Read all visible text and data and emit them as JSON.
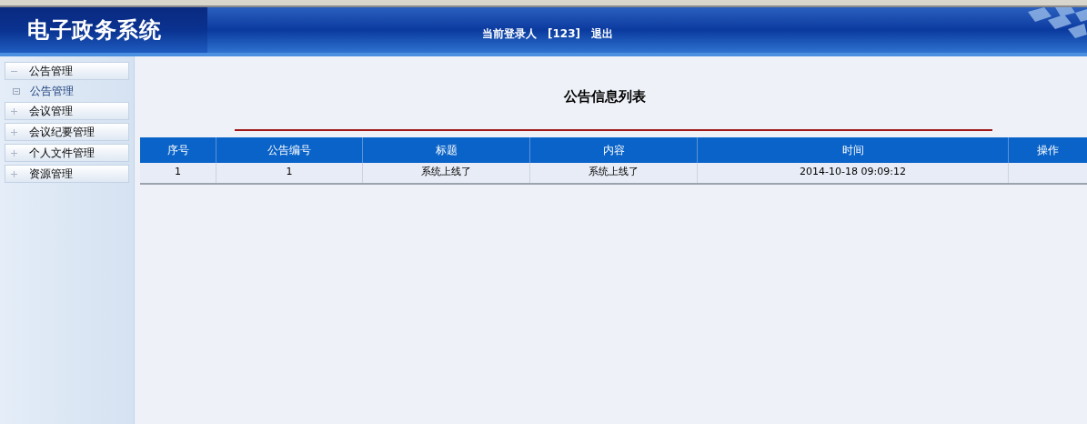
{
  "header": {
    "logo": "电子政务系统",
    "user_label": "当前登录人",
    "user_name": "[123]",
    "logout": "退出"
  },
  "sidebar": {
    "groups": [
      {
        "label": "公告管理",
        "expanded": true,
        "children": [
          {
            "label": "公告管理"
          }
        ]
      },
      {
        "label": "会议管理",
        "expanded": false
      },
      {
        "label": "会议纪要管理",
        "expanded": false
      },
      {
        "label": "个人文件管理",
        "expanded": false
      },
      {
        "label": "资源管理",
        "expanded": false
      }
    ]
  },
  "main": {
    "title": "公告信息列表",
    "table": {
      "columns": [
        "序号",
        "公告编号",
        "标题",
        "内容",
        "时间",
        "操作"
      ],
      "rows": [
        [
          "1",
          "1",
          "系统上线了",
          "系统上线了",
          "2014-10-18 09:09:12",
          null
        ]
      ]
    }
  }
}
